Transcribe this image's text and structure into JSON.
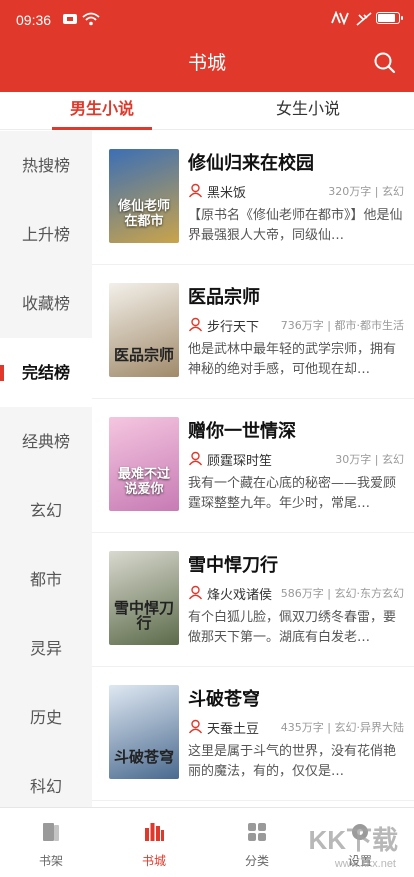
{
  "status_bar": {
    "time": "09:36",
    "battery_level": 0.9
  },
  "header": {
    "title": "书城",
    "search_icon": "search-icon"
  },
  "tabs": [
    {
      "label": "男生小说",
      "active": true
    },
    {
      "label": "女生小说",
      "active": false
    }
  ],
  "sidebar": {
    "items": [
      {
        "label": "热搜榜"
      },
      {
        "label": "上升榜"
      },
      {
        "label": "收藏榜"
      },
      {
        "label": "完结榜",
        "active": true
      },
      {
        "label": "经典榜"
      },
      {
        "label": "玄幻"
      },
      {
        "label": "都市"
      },
      {
        "label": "灵异"
      },
      {
        "label": "历史"
      },
      {
        "label": "科幻"
      }
    ]
  },
  "books": [
    {
      "title": "修仙归来在校园",
      "author": "黑米饭",
      "meta": "320万字 | 玄幻",
      "desc": "【原书名《修仙老师在都市》】他是仙界最强狠人大帝，同级仙…",
      "cover_text": "修仙老师在都市",
      "cover_colors": [
        "#3b6fb5",
        "#caa44a"
      ]
    },
    {
      "title": "医品宗师",
      "author": "步行天下",
      "meta": "736万字 | 都市·都市生活",
      "desc": "他是武林中最年轻的武学宗师，拥有神秘的绝对手感，可他现在却…",
      "cover_text": "医品宗师",
      "cover_colors": [
        "#f3f0ea",
        "#a08a6a"
      ]
    },
    {
      "title": "赠你一世情深",
      "author": "顾霆琛时笙",
      "meta": "30万字 | 玄幻",
      "desc": "我有一个藏在心底的秘密——我爱顾霆琛整整九年。年少时，常尾…",
      "cover_text": "最难不过说爱你",
      "cover_colors": [
        "#f5c6e0",
        "#c77bb4"
      ]
    },
    {
      "title": "雪中悍刀行",
      "author": "烽火戏诸侯",
      "meta": "586万字 | 玄幻·东方玄幻",
      "desc": "有个白狐儿脸，佩双刀绣冬春雷，要做那天下第一。湖底有白发老…",
      "cover_text": "雪中悍刀行",
      "cover_colors": [
        "#d9d9cf",
        "#5c6b4a"
      ]
    },
    {
      "title": "斗破苍穹",
      "author": "天蚕土豆",
      "meta": "435万字 | 玄幻·异界大陆",
      "desc": "这里是属于斗气的世界，没有花俏艳丽的魔法，有的，仅仅是…",
      "cover_text": "斗破苍穹",
      "cover_colors": [
        "#dfe8f2",
        "#4a6a8f"
      ]
    }
  ],
  "bottom_nav": [
    {
      "label": "书架",
      "icon": "bookshelf-icon"
    },
    {
      "label": "书城",
      "icon": "bookstore-icon",
      "active": true
    },
    {
      "label": "分类",
      "icon": "category-icon"
    },
    {
      "label": "设置",
      "icon": "settings-icon"
    }
  ],
  "watermark": {
    "text": "KK下载",
    "sub": "www.kkx.net"
  },
  "colors": {
    "accent": "#e0392b",
    "sidebar_bg": "#f5f5f5"
  }
}
